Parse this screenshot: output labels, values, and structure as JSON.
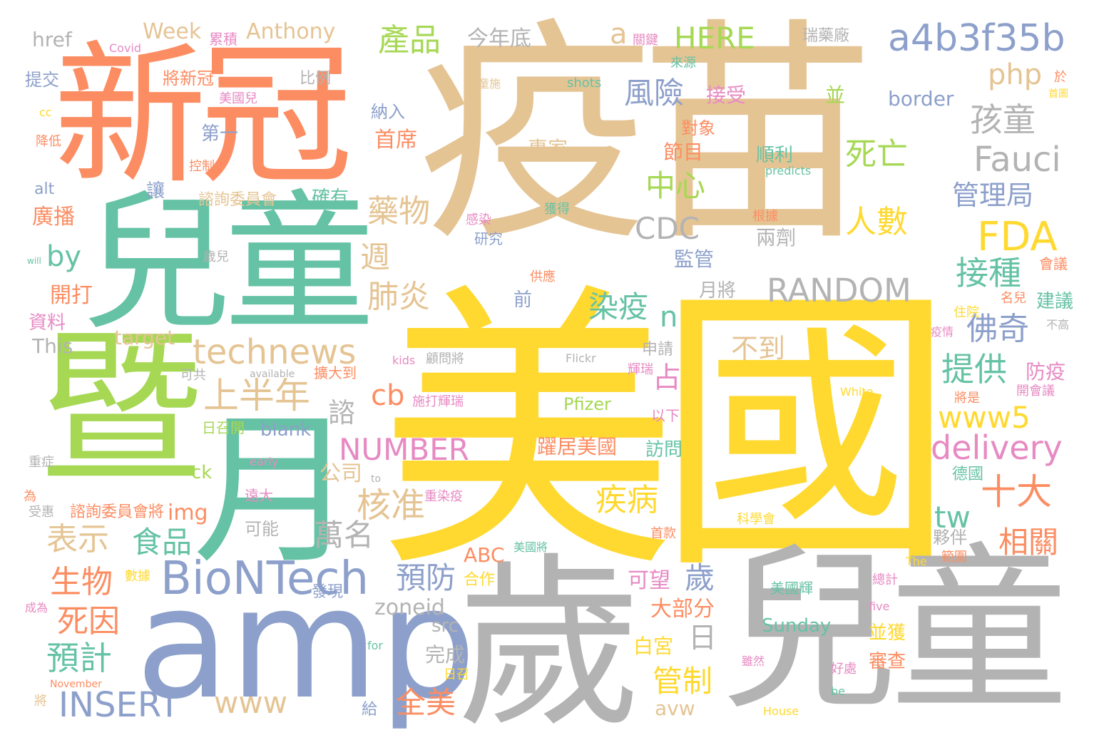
{
  "palette": {
    "orange": "#fc8d62",
    "teal": "#66c2a5",
    "blue": "#8da0cb",
    "pink": "#e78ac3",
    "green": "#a6d854",
    "yellow": "#ffd92f",
    "tan": "#e5c494",
    "gray": "#b3b3b3"
  },
  "words": [
    {
      "text": "疫苗",
      "color": "tan"
    },
    {
      "text": "美國",
      "color": "yellow"
    },
    {
      "text": "兒童",
      "color": "gray"
    },
    {
      "text": "新冠",
      "color": "orange"
    },
    {
      "text": "兒童",
      "color": "teal"
    },
    {
      "text": "暨",
      "color": "green"
    },
    {
      "text": "月",
      "color": "teal"
    },
    {
      "text": "amp",
      "color": "blue"
    },
    {
      "text": "歲",
      "color": "gray"
    },
    {
      "text": "a4b3f35b",
      "color": "blue"
    },
    {
      "text": "FDA",
      "color": "yellow"
    },
    {
      "text": "BioNTech",
      "color": "blue"
    },
    {
      "text": "technews",
      "color": "tan"
    },
    {
      "text": "RANDOM",
      "color": "gray"
    },
    {
      "text": "NUMBER",
      "color": "pink"
    },
    {
      "text": "INSERT",
      "color": "blue"
    },
    {
      "text": "delivery",
      "color": "pink"
    },
    {
      "text": "www5",
      "color": "yellow"
    },
    {
      "text": "Fauci",
      "color": "gray"
    },
    {
      "text": "HERE",
      "color": "green"
    },
    {
      "text": "CDC",
      "color": "gray"
    },
    {
      "text": "php",
      "color": "tan"
    },
    {
      "text": "www",
      "color": "tan"
    },
    {
      "text": "zoneid",
      "color": "gray"
    },
    {
      "text": "cb",
      "color": "orange"
    },
    {
      "text": "tw",
      "color": "teal"
    },
    {
      "text": "by",
      "color": "teal"
    },
    {
      "text": "a",
      "color": "tan"
    },
    {
      "text": "n",
      "color": "teal"
    },
    {
      "text": "產品",
      "color": "green"
    },
    {
      "text": "風險",
      "color": "blue"
    },
    {
      "text": "孩童",
      "color": "gray"
    },
    {
      "text": "死亡",
      "color": "green"
    },
    {
      "text": "人數",
      "color": "yellow"
    },
    {
      "text": "中心",
      "color": "green"
    },
    {
      "text": "管理局",
      "color": "blue"
    },
    {
      "text": "藥物",
      "color": "tan"
    },
    {
      "text": "接種",
      "color": "teal"
    },
    {
      "text": "佛奇",
      "color": "blue"
    },
    {
      "text": "提供",
      "color": "teal"
    },
    {
      "text": "肺炎",
      "color": "tan"
    },
    {
      "text": "染疫",
      "color": "teal"
    },
    {
      "text": "上半年",
      "color": "tan"
    },
    {
      "text": "十大",
      "color": "orange"
    },
    {
      "text": "表示",
      "color": "tan"
    },
    {
      "text": "食品",
      "color": "teal"
    },
    {
      "text": "核准",
      "color": "tan"
    },
    {
      "text": "萬名",
      "color": "gray"
    },
    {
      "text": "疾病",
      "color": "yellow"
    },
    {
      "text": "相關",
      "color": "orange"
    },
    {
      "text": "生物",
      "color": "orange"
    },
    {
      "text": "預防",
      "color": "blue"
    },
    {
      "text": "死因",
      "color": "orange"
    },
    {
      "text": "預計",
      "color": "teal"
    },
    {
      "text": "全美",
      "color": "orange"
    },
    {
      "text": "管制",
      "color": "yellow"
    },
    {
      "text": "不到",
      "color": "tan"
    },
    {
      "text": "Anthony",
      "color": "tan"
    },
    {
      "text": "Week",
      "color": "tan"
    },
    {
      "text": "href",
      "color": "gray"
    },
    {
      "text": "今年底",
      "color": "gray"
    },
    {
      "text": "首席",
      "color": "orange"
    },
    {
      "text": "接受",
      "color": "pink"
    },
    {
      "text": "border",
      "color": "blue"
    },
    {
      "text": "順利",
      "color": "teal"
    },
    {
      "text": "專家",
      "color": "tan"
    },
    {
      "text": "節目",
      "color": "orange"
    },
    {
      "text": "兩劑",
      "color": "gray"
    },
    {
      "text": "監管",
      "color": "blue"
    },
    {
      "text": "月將",
      "color": "gray"
    },
    {
      "text": "週",
      "color": "tan"
    },
    {
      "text": "占",
      "color": "pink"
    },
    {
      "text": "諮",
      "color": "gray"
    },
    {
      "text": "歲",
      "color": "blue"
    },
    {
      "text": "日",
      "color": "gray"
    },
    {
      "text": "blank",
      "color": "blue"
    },
    {
      "text": "Pfizer",
      "color": "green"
    },
    {
      "text": "target",
      "color": "tan"
    },
    {
      "text": "This",
      "color": "gray"
    },
    {
      "text": "img",
      "color": "orange"
    },
    {
      "text": "ABC",
      "color": "orange"
    },
    {
      "text": "src",
      "color": "gray"
    },
    {
      "text": "avw",
      "color": "tan"
    },
    {
      "text": "Sunday",
      "color": "teal"
    },
    {
      "text": "公司",
      "color": "tan"
    },
    {
      "text": "可能",
      "color": "gray"
    },
    {
      "text": "合作",
      "color": "yellow"
    },
    {
      "text": "可望",
      "color": "pink"
    },
    {
      "text": "大部分",
      "color": "orange"
    },
    {
      "text": "白宮",
      "color": "yellow"
    },
    {
      "text": "完成",
      "color": "gray"
    },
    {
      "text": "躍居美國",
      "color": "orange"
    },
    {
      "text": "訪問",
      "color": "teal"
    },
    {
      "text": "防疫",
      "color": "pink"
    },
    {
      "text": "建議",
      "color": "teal"
    },
    {
      "text": "審查",
      "color": "orange"
    },
    {
      "text": "並獲",
      "color": "yellow"
    },
    {
      "text": "夥伴",
      "color": "gray"
    },
    {
      "text": "第一",
      "color": "blue"
    },
    {
      "text": "廣播",
      "color": "orange"
    },
    {
      "text": "開打",
      "color": "orange"
    },
    {
      "text": "資料",
      "color": "pink"
    },
    {
      "text": "提交",
      "color": "blue"
    },
    {
      "text": "將新冠",
      "color": "orange"
    },
    {
      "text": "讓",
      "color": "blue"
    },
    {
      "text": "確有",
      "color": "teal"
    },
    {
      "text": "諮詢委員會",
      "color": "tan"
    },
    {
      "text": "研究",
      "color": "blue"
    },
    {
      "text": "發現",
      "color": "blue"
    },
    {
      "text": "並",
      "color": "green"
    },
    {
      "text": "前",
      "color": "blue"
    },
    {
      "text": "美國輝",
      "color": "teal"
    },
    {
      "text": "給",
      "color": "blue"
    },
    {
      "text": "申請",
      "color": "gray"
    },
    {
      "text": "Covid",
      "color": "pink"
    },
    {
      "text": "累積",
      "color": "pink"
    },
    {
      "text": "關鍵",
      "color": "pink"
    },
    {
      "text": "瑞藥廠",
      "color": "gray"
    },
    {
      "text": "比例",
      "color": "gray"
    },
    {
      "text": "美國兒",
      "color": "pink"
    },
    {
      "text": "來源",
      "color": "teal"
    },
    {
      "text": "shots",
      "color": "teal"
    },
    {
      "text": "對象",
      "color": "orange"
    },
    {
      "text": "納入",
      "color": "blue"
    },
    {
      "text": "predicts",
      "color": "teal"
    },
    {
      "text": "感染",
      "color": "pink"
    },
    {
      "text": "獲得",
      "color": "teal"
    },
    {
      "text": "根據",
      "color": "orange"
    },
    {
      "text": "控制",
      "color": "orange"
    },
    {
      "text": "降低",
      "color": "orange"
    },
    {
      "text": "cc",
      "color": "yellow"
    },
    {
      "text": "alt",
      "color": "blue"
    },
    {
      "text": "will",
      "color": "teal"
    },
    {
      "text": "歲兒",
      "color": "gray"
    },
    {
      "text": "供應",
      "color": "orange"
    },
    {
      "text": "會議",
      "color": "orange"
    },
    {
      "text": "名兒",
      "color": "orange"
    },
    {
      "text": "住院",
      "color": "yellow"
    },
    {
      "text": "疫情",
      "color": "pink"
    },
    {
      "text": "不高",
      "color": "gray"
    },
    {
      "text": "可共",
      "color": "gray"
    },
    {
      "text": "available",
      "color": "gray"
    },
    {
      "text": "擴大到",
      "color": "orange"
    },
    {
      "text": "kids",
      "color": "pink"
    },
    {
      "text": "顧問將",
      "color": "gray"
    },
    {
      "text": "Flickr",
      "color": "gray"
    },
    {
      "text": "輝瑞",
      "color": "pink"
    },
    {
      "text": "White",
      "color": "yellow"
    },
    {
      "text": "施打輝瑞",
      "color": "pink"
    },
    {
      "text": "將是",
      "color": "orange"
    },
    {
      "text": "開會議",
      "color": "pink"
    },
    {
      "text": "以下",
      "color": "pink"
    },
    {
      "text": "日召開",
      "color": "green"
    },
    {
      "text": "重症",
      "color": "gray"
    },
    {
      "text": "early",
      "color": "pink"
    },
    {
      "text": "to",
      "color": "gray"
    },
    {
      "text": "遠大",
      "color": "pink"
    },
    {
      "text": "為",
      "color": "orange"
    },
    {
      "text": "受惠",
      "color": "gray"
    },
    {
      "text": "諮詢委員會將",
      "color": "orange"
    },
    {
      "text": "重染疫",
      "color": "pink"
    },
    {
      "text": "德國",
      "color": "teal"
    },
    {
      "text": "科學會",
      "color": "yellow"
    },
    {
      "text": "首款",
      "color": "orange"
    },
    {
      "text": "美國將",
      "color": "teal"
    },
    {
      "text": "The",
      "color": "yellow"
    },
    {
      "text": "範圍",
      "color": "orange"
    },
    {
      "text": "數據",
      "color": "yellow"
    },
    {
      "text": "成為",
      "color": "pink"
    },
    {
      "text": "總計",
      "color": "pink"
    },
    {
      "text": "five",
      "color": "pink"
    },
    {
      "text": "for",
      "color": "teal"
    },
    {
      "text": "November",
      "color": "orange"
    },
    {
      "text": "日召",
      "color": "yellow"
    },
    {
      "text": "雖然",
      "color": "pink"
    },
    {
      "text": "好處",
      "color": "pink"
    },
    {
      "text": "House",
      "color": "yellow"
    },
    {
      "text": "be",
      "color": "teal"
    },
    {
      "text": "將",
      "color": "tan"
    },
    {
      "text": "ck",
      "color": "green"
    },
    {
      "text": "童施",
      "color": "tan"
    },
    {
      "text": "於",
      "color": "orange"
    },
    {
      "text": "首圖",
      "color": "yellow"
    }
  ]
}
